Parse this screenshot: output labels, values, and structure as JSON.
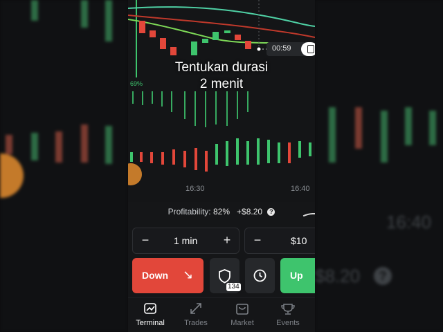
{
  "overlay": {
    "caption_line1": "Tentukan durasi",
    "caption_line2": "2 menit"
  },
  "chart": {
    "percent_label": "69%",
    "time_labels": [
      "16:30",
      "16:40"
    ],
    "timer": "00:59",
    "colors": {
      "up": "#3ec46d",
      "down": "#e2473a",
      "ma_fast": "#4fd1a5",
      "ma_mid": "#7ed957",
      "ma_slow": "#c0392b"
    }
  },
  "profitability": {
    "label": "Profitability:",
    "percent": "82%",
    "payout": "+$8.20",
    "help_icon": "?"
  },
  "duration": {
    "minus": "−",
    "value": "1 min",
    "plus": "+"
  },
  "amount": {
    "minus": "−",
    "value": "$10"
  },
  "actions": {
    "down_label": "Down",
    "down_icon": "arrow-down-right-icon",
    "shield_icon": "shield-icon",
    "shield_badge": "134",
    "clock_icon": "clock-icon",
    "up_label": "Up"
  },
  "tabs": [
    {
      "label": "Terminal",
      "icon": "chart-icon",
      "active": true
    },
    {
      "label": "Trades",
      "icon": "arrows-icon",
      "active": false
    },
    {
      "label": "Market",
      "icon": "bag-icon",
      "active": false
    },
    {
      "label": "Events",
      "icon": "trophy-icon",
      "active": false
    }
  ],
  "background": {
    "ghost_time": "16:40",
    "ghost_payout": "$8.20",
    "ghost_help": "?"
  }
}
